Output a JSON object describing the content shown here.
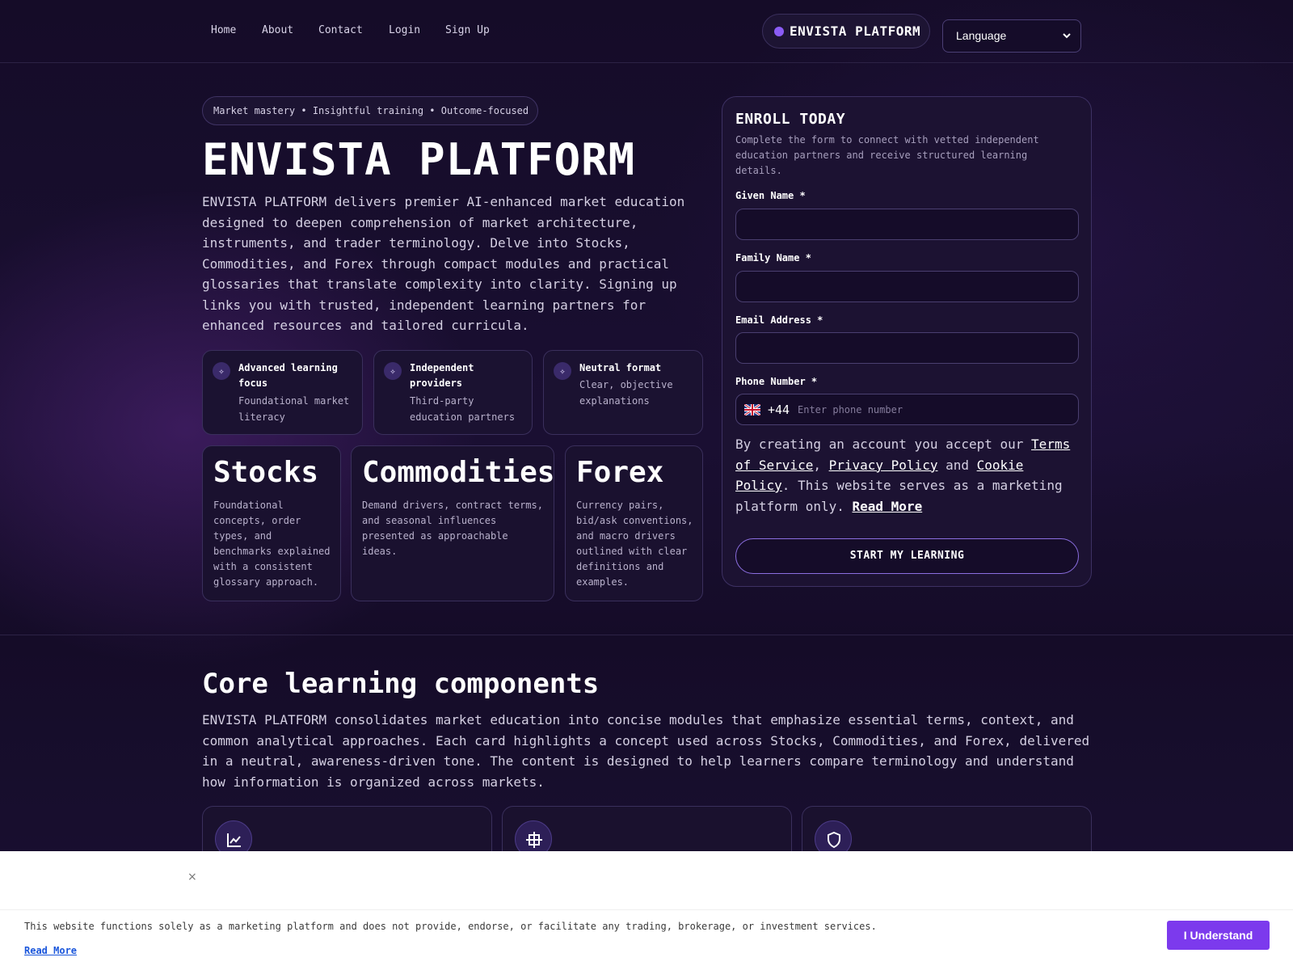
{
  "nav": {
    "links": [
      "Home",
      "About",
      "Contact",
      "Login",
      "Sign Up"
    ],
    "brand": "ENVISTA PLATFORM",
    "language_label": "Language"
  },
  "hero": {
    "tagline": "Market mastery • Insightful training • Outcome-focused",
    "title": "ENVISTA PLATFORM",
    "description": "ENVISTA PLATFORM delivers premier AI-enhanced market education designed to deepen comprehension of market architecture, instruments, and trader terminology. Delve into Stocks, Commodities, and Forex through compact modules and practical glossaries that translate complexity into clarity. Signing up links you with trusted, independent learning partners for enhanced resources and tailored curricula.",
    "features": [
      {
        "title": "Advanced learning focus",
        "subtitle": "Foundational market literacy",
        "icon": "sparkle-icon"
      },
      {
        "title": "Independent providers",
        "subtitle": "Third-party education partners",
        "icon": "sparkle-icon"
      },
      {
        "title": "Neutral format",
        "subtitle": "Clear, objective explanations",
        "icon": "sparkle-icon"
      }
    ],
    "markets": [
      {
        "title": "Stocks",
        "description": "Foundational concepts, order types, and benchmarks explained with a consistent glossary approach."
      },
      {
        "title": "Commodities",
        "description": "Demand drivers, contract terms, and seasonal influences presented as approachable ideas."
      },
      {
        "title": "Forex",
        "description": "Currency pairs, bid/ask conventions, and macro drivers outlined with clear definitions and examples."
      }
    ]
  },
  "form": {
    "title": "ENROLL TODAY",
    "description": "Complete the form to connect with vetted independent education partners and receive structured learning details.",
    "given_name_label": "Given Name *",
    "given_name_value": "",
    "family_name_label": "Family Name *",
    "family_name_value": "",
    "email_label": "Email Address *",
    "email_value": "",
    "phone_label": "Phone Number *",
    "phone_country_code": "+44",
    "phone_placeholder": "Enter phone number",
    "legal_prefix": "By creating an account you accept our ",
    "terms_link": "Terms of Service",
    "sep1": ", ",
    "privacy_link": "Privacy Policy",
    "sep2": " and ",
    "cookie_link": "Cookie Policy",
    "legal_suffix": ". This website serves as a marketing platform only. ",
    "read_more_link": "Read More",
    "submit_label": "START MY LEARNING"
  },
  "core": {
    "title": "Core learning components",
    "description": "ENVISTA PLATFORM consolidates market education into concise modules that emphasize essential terms, context, and common analytical approaches. Each card highlights a concept used across Stocks, Commodities, and Forex, delivered in a neutral, awareness-driven tone. The content is designed to help learners compare terminology and understand how information is organized across markets.",
    "cards": [
      {
        "icon": "line-chart-icon"
      },
      {
        "icon": "crosshair-grid-icon"
      },
      {
        "icon": "shield-icon"
      }
    ]
  },
  "cookie_banner": {
    "close": "×",
    "text": "This website functions solely as a marketing platform and does not provide, endorse, or facilitate any trading, brokerage, or investment services.",
    "read_more": "Read More",
    "button": "I Understand"
  },
  "colors": {
    "background": "#140d26",
    "accent": "#8b5cf6",
    "cta_border": "#8b6ee0",
    "banner_button": "#7c3aed"
  }
}
